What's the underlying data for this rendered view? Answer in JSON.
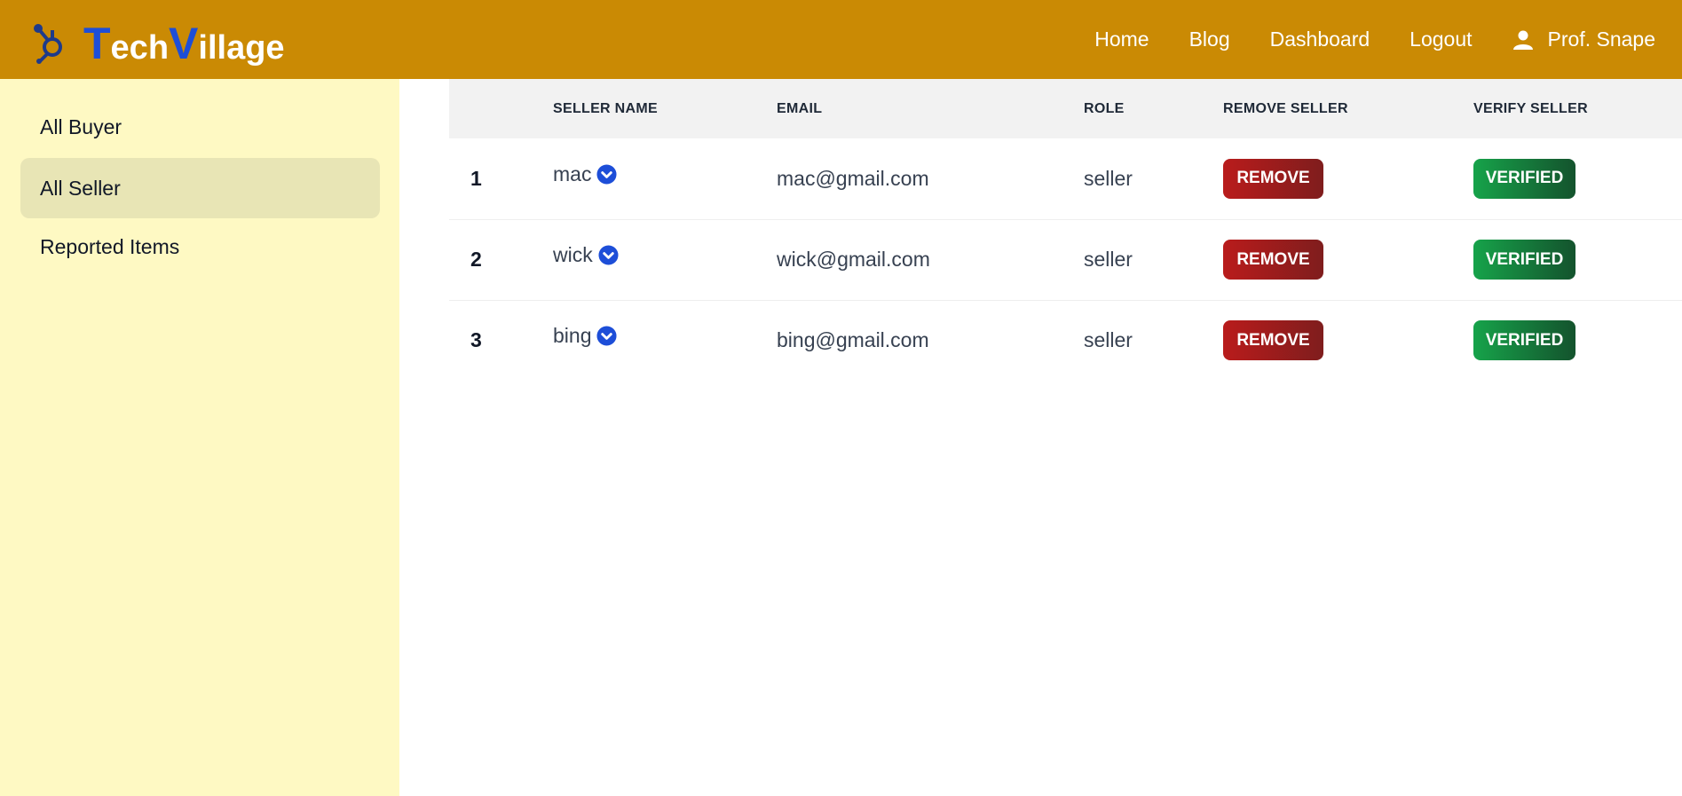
{
  "brand": {
    "first_letter": "T",
    "first_rest": "ech",
    "second_letter": "V",
    "second_rest": "illage"
  },
  "nav": {
    "home": "Home",
    "blog": "Blog",
    "dashboard": "Dashboard",
    "logout": "Logout",
    "user": "Prof. Snape"
  },
  "sidebar": {
    "items": [
      {
        "label": "All Buyer"
      },
      {
        "label": "All Seller"
      },
      {
        "label": "Reported Items"
      }
    ]
  },
  "table": {
    "headers": {
      "index": "",
      "name": "SELLER NAME",
      "email": "EMAIL",
      "role": "ROLE",
      "remove": "REMOVE SELLER",
      "verify": "VERIFY SELLER"
    },
    "rows": [
      {
        "index": "1",
        "name": "mac",
        "email": "mac@gmail.com",
        "role": "seller",
        "remove": "REMOVE",
        "verify": "VERIFIED"
      },
      {
        "index": "2",
        "name": "wick",
        "email": "wick@gmail.com",
        "role": "seller",
        "remove": "REMOVE",
        "verify": "VERIFIED"
      },
      {
        "index": "3",
        "name": "bing",
        "email": "bing@gmail.com",
        "role": "seller",
        "remove": "REMOVE",
        "verify": "VERIFIED"
      }
    ]
  },
  "colors": {
    "navbar": "#ca8a04",
    "sidebar": "#fef9c3",
    "brand_accent": "#1d4ed8",
    "remove": "#b91c1c",
    "verified": "#16a34a"
  },
  "icons": {
    "logo": "hub-icon",
    "user": "user-icon",
    "verified_badge": "chevron-down-circle-icon"
  }
}
